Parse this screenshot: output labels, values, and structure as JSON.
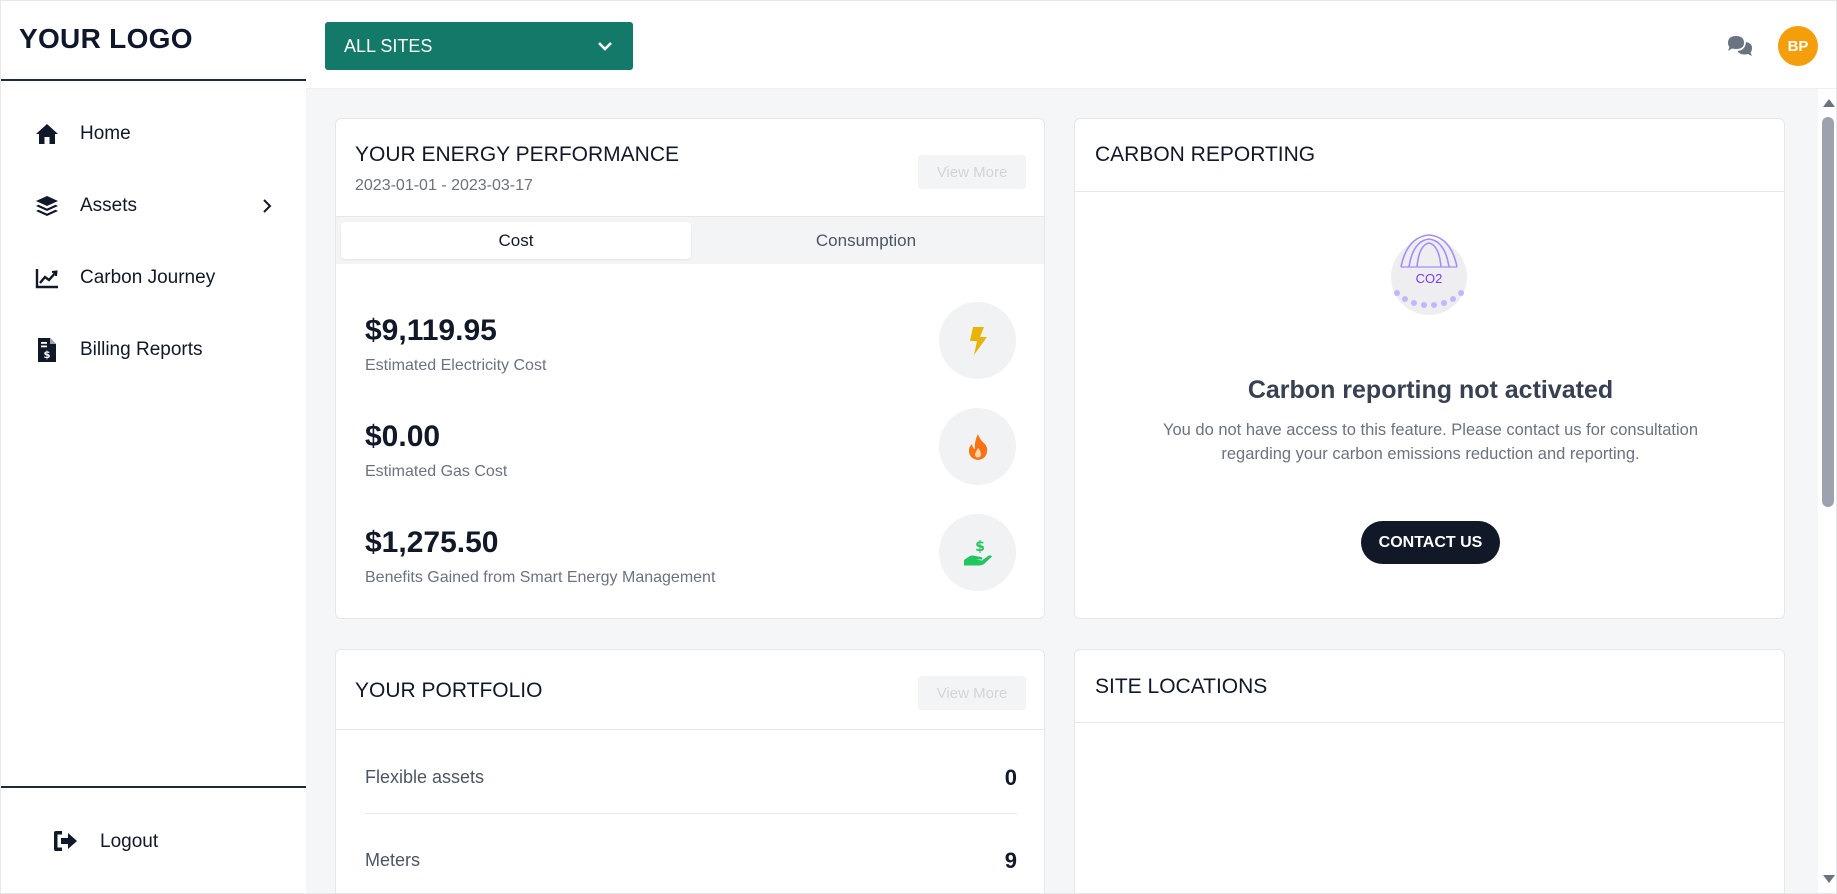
{
  "brand": {
    "logo": "YOUR LOGO"
  },
  "sidebar": {
    "items": [
      {
        "label": "Home",
        "icon": "home-icon"
      },
      {
        "label": "Assets",
        "icon": "layers-icon",
        "has_submenu": true
      },
      {
        "label": "Carbon Journey",
        "icon": "chart-line-icon"
      },
      {
        "label": "Billing Reports",
        "icon": "invoice-dollar-icon"
      }
    ],
    "logout": {
      "label": "Logout",
      "icon": "sign-out-icon"
    }
  },
  "topbar": {
    "site_select": "ALL SITES",
    "avatar_initials": "BP",
    "avatar_color": "#f59e0b",
    "accent_color": "#137a6a"
  },
  "energy": {
    "title": "YOUR ENERGY PERFORMANCE",
    "date_range": "2023-01-01 - 2023-03-17",
    "view_more": "View More",
    "tabs": [
      {
        "label": "Cost",
        "active": true
      },
      {
        "label": "Consumption",
        "active": false
      }
    ],
    "metrics": [
      {
        "value": "$9,119.95",
        "label": "Estimated Electricity Cost",
        "icon": "bolt-icon",
        "color": "#eab308"
      },
      {
        "value": "$0.00",
        "label": "Estimated Gas Cost",
        "icon": "fire-icon",
        "color": "#f97316"
      },
      {
        "value": "$1,275.50",
        "label": "Benefits Gained from Smart Energy Management",
        "icon": "hand-dollar-icon",
        "color": "#22c55e"
      }
    ]
  },
  "carbon": {
    "title": "CARBON REPORTING",
    "icon_text": "CO2",
    "heading": "Carbon reporting not activated",
    "description": "You do not have access to this feature. Please contact us for consultation regarding your carbon emissions reduction and reporting.",
    "button": "CONTACT US"
  },
  "portfolio": {
    "title": "YOUR PORTFOLIO",
    "view_more": "View More",
    "rows": [
      {
        "label": "Flexible assets",
        "value": "0"
      },
      {
        "label": "Meters",
        "value": "9"
      }
    ]
  },
  "sites": {
    "title": "SITE LOCATIONS"
  }
}
